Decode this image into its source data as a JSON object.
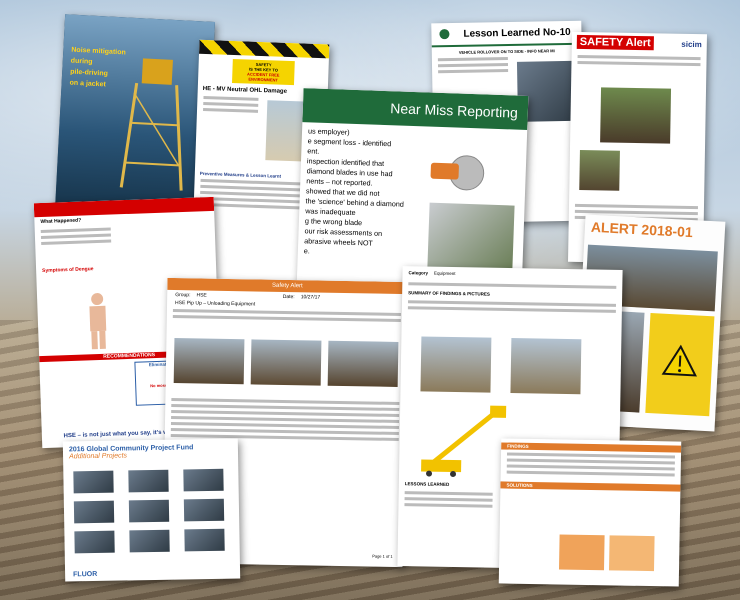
{
  "docs": {
    "noise": {
      "lines": [
        "Noise mitigation",
        "during",
        "pile-driving",
        "on a jacket"
      ]
    },
    "hvs": {
      "sign_top": "SAFETY",
      "sign_mid": "IS THE KEY TO",
      "sign_bot": "ACCIDENT FREE ENVIRONMENT",
      "title": "HE - MV Neutral OHL Damage",
      "preventive": "Preventive Measures & Lesson Learnt"
    },
    "lesson": {
      "title": "Lesson Learned No-10",
      "subtitle": "VEHICLE ROLLOVER ON TO SIDE - INFO NEAR MI"
    },
    "sicim": {
      "title": "SAFETY Alert",
      "brand": "sicim"
    },
    "near_miss": {
      "title": "Near Miss Reporting",
      "lines": [
        "us employer)",
        "e segment loss - identified",
        "ent.",
        "inspection identified that",
        "diamond blades in use had",
        "nents – not reported.",
        "showed that we did not",
        "the 'science' behind a diamond",
        "was inadequate",
        "g the wrong blade",
        "our risk assessments on",
        "abrasive wheels NOT",
        "e."
      ]
    },
    "alert2018": {
      "title": "ALERT 2018-01"
    },
    "dengue": {
      "what_happened": "What Happened?",
      "symptoms": "Symptoms of Dengue",
      "recommendations": "RECOMMENDATIONS",
      "eliminate": "Eliminate breeding sites!",
      "no_mosquitoes": "No mosquitoes no Dengue!",
      "footer": "HSE – is not just what you say, it's what you do!"
    },
    "unloading": {
      "title": "Safety Alert",
      "group_label": "Group:",
      "group_value": "HSE",
      "date_label": "Date:",
      "date_value": "10/27/17",
      "subject": "HSE Pip Up – Unloading Equipment",
      "page": "Page 1 of 1"
    },
    "fall": {
      "header": "SUMMARY OF FINDINGS & PICTURES",
      "lessons": "LESSONS LEARNED",
      "category": "Category",
      "category_value": "Equipment"
    },
    "fund": {
      "title": "2016 Global Community Project Fund",
      "subtitle": "Additional Projects",
      "brand": "FLUOR"
    },
    "findings": {
      "findings": "FINDINGS",
      "solutions": "SOLUTIONS"
    }
  },
  "colors": {
    "red": "#d40000",
    "green": "#1f6b3a",
    "orange": "#e07a2a",
    "blue": "#2b5ea7"
  }
}
